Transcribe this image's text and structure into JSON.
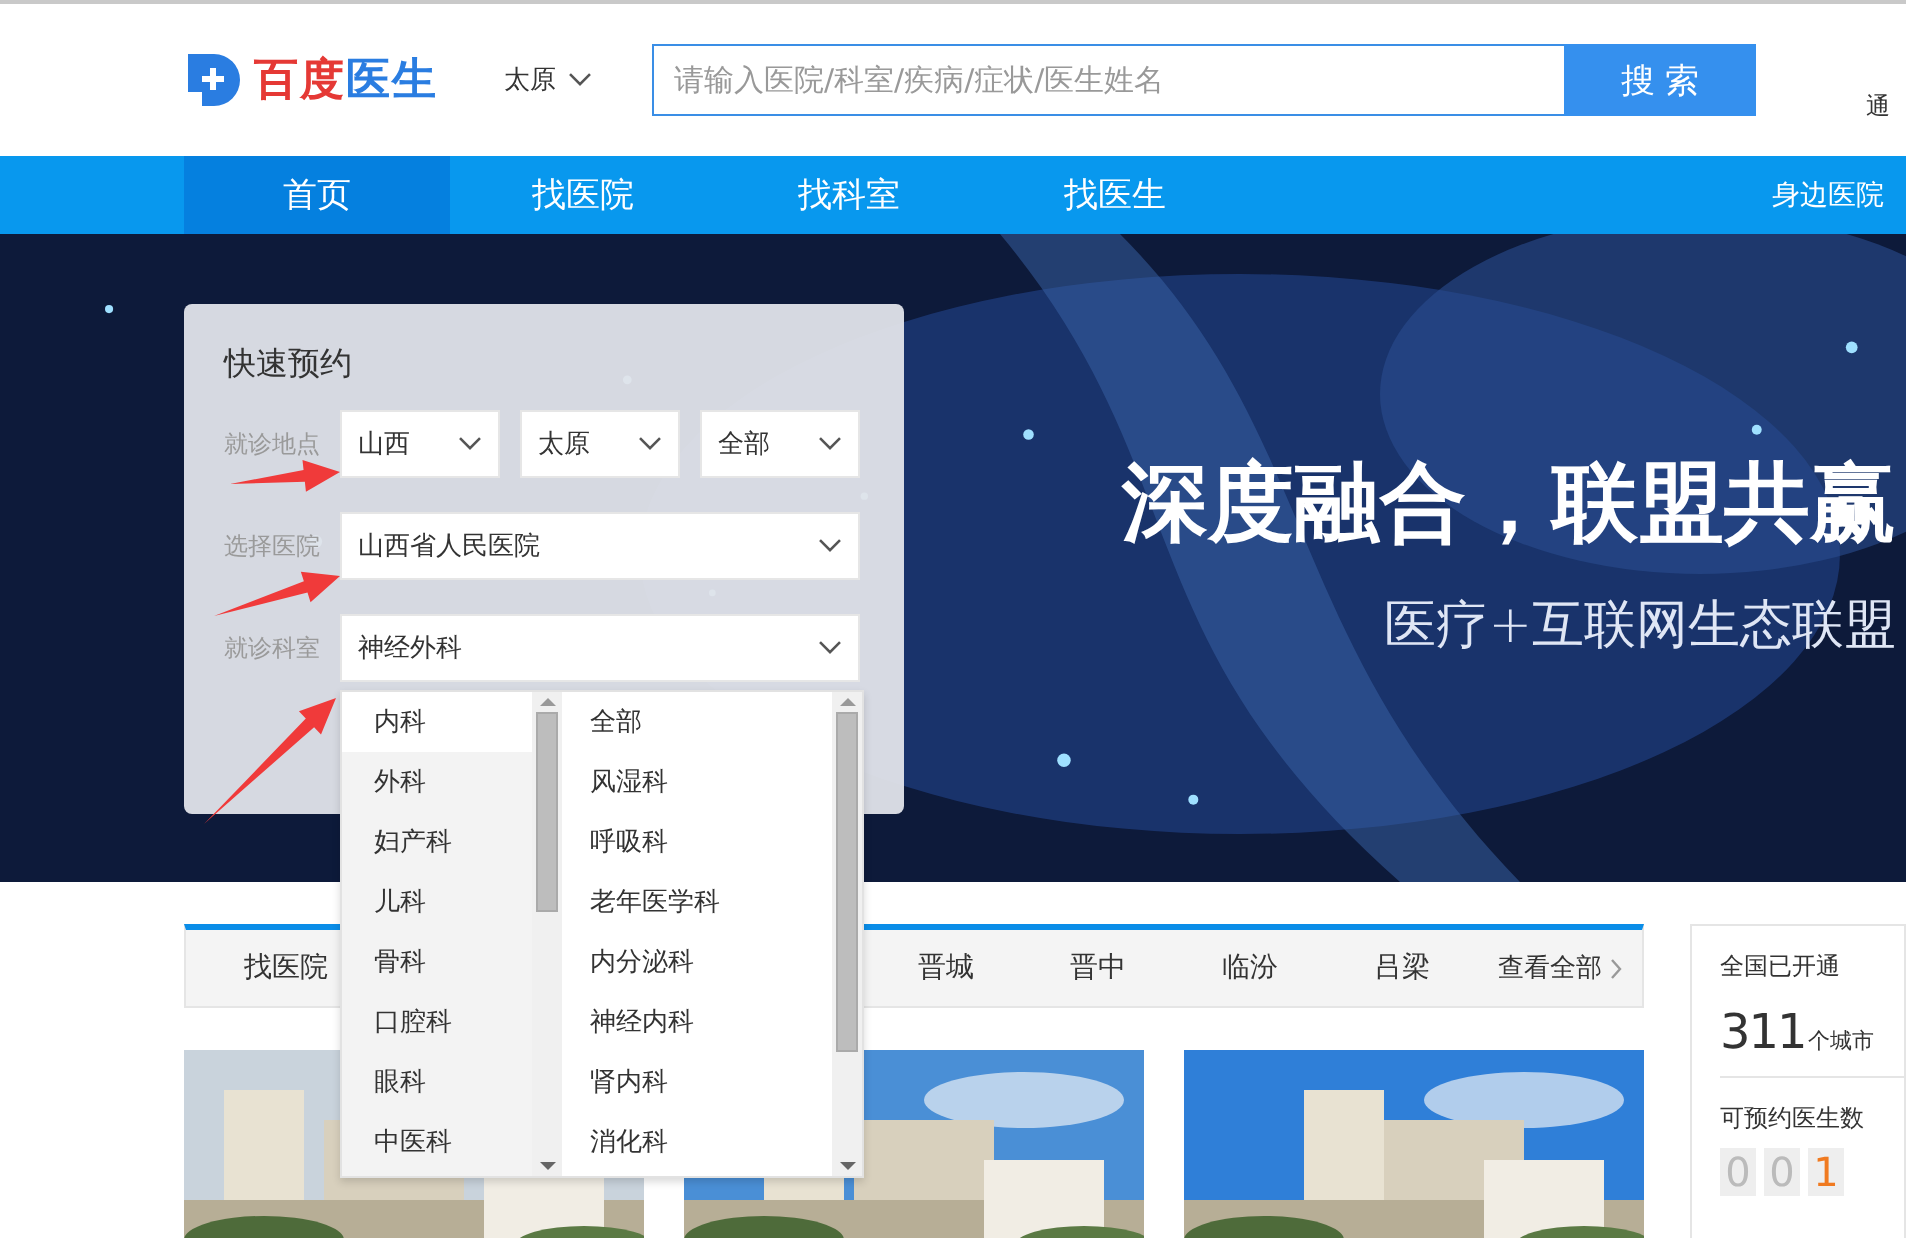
{
  "header": {
    "logo": {
      "brand": "百度",
      "product": "医生"
    },
    "city_select": {
      "value": "太原"
    },
    "search": {
      "placeholder": "请输入医院/科室/疾病/症状/医生姓名",
      "button": "搜 索"
    },
    "notice_link": "通"
  },
  "nav": {
    "items": [
      {
        "label": "首页",
        "selected": true
      },
      {
        "label": "找医院",
        "selected": false
      },
      {
        "label": "找科室",
        "selected": false
      },
      {
        "label": "找医生",
        "selected": false
      }
    ],
    "right_link": "身边医院"
  },
  "banner": {
    "headline": "深度融合，联盟共赢",
    "subtitle": "医疗+互联网生态联盟"
  },
  "quick_booking": {
    "title": "快速预约",
    "rows": [
      {
        "label": "就诊地点",
        "selects": [
          "山西",
          "太原",
          "全部"
        ]
      },
      {
        "label": "选择医院",
        "selects": [
          "山西省人民医院"
        ]
      },
      {
        "label": "就诊科室",
        "selects": [
          "神经外科"
        ]
      }
    ]
  },
  "department_dropdown": {
    "categories": [
      {
        "label": "内科",
        "selected": true
      },
      {
        "label": "外科",
        "selected": false
      },
      {
        "label": "妇产科",
        "selected": false
      },
      {
        "label": "儿科",
        "selected": false
      },
      {
        "label": "骨科",
        "selected": false
      },
      {
        "label": "口腔科",
        "selected": false
      },
      {
        "label": "眼科",
        "selected": false
      },
      {
        "label": "中医科",
        "selected": false
      }
    ],
    "departments": [
      "全部",
      "风湿科",
      "呼吸科",
      "老年医学科",
      "内分泌科",
      "神经内科",
      "肾内科",
      "消化科"
    ]
  },
  "region_tabs": {
    "label": "找医院",
    "items": [
      "晋城",
      "晋中",
      "临汾",
      "吕梁"
    ],
    "more": "查看全部"
  },
  "stats_card": {
    "cities_title": "全国已开通",
    "cities_count": "311",
    "cities_unit": "个城市",
    "doctors_title": "可预约医生数",
    "doctor_digits": [
      {
        "digit": "0",
        "highlighted": false
      },
      {
        "digit": "0",
        "highlighted": false
      },
      {
        "digit": "1",
        "highlighted": true
      }
    ]
  }
}
